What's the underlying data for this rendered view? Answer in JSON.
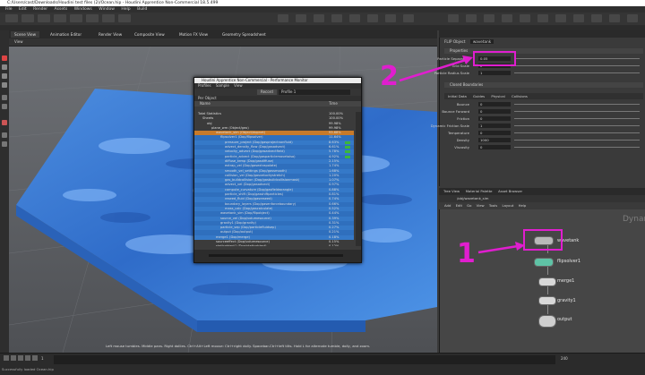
{
  "window": {
    "title": "C:/Users/cast/Downloads/Houdini test files (2)/Ocean.hip - Houdini Apprentice Non-Commercial 18.5.499"
  },
  "menu": [
    "File",
    "Edit",
    "Render",
    "Assets",
    "Windows",
    "Window",
    "Help",
    "Build"
  ],
  "viewport": {
    "tabs": [
      "Scene View",
      "Animation Editor",
      "Render View",
      "Composite View",
      "Motion FX View",
      "Geometry Spreadsheet"
    ],
    "toolbar_label": "View",
    "path": "/obj/wavetank_sim",
    "hint": "Left mouse tumbles. Middle pans. Right dollies. Ctrl+Alt+Left mouse: Ctrl+right dolly. Spacebar-Ctrl+left tilts. Hold L for alternate tumble, dolly, and zoom."
  },
  "perf": {
    "title": "Houdini Apprentice Non-Commercial - Performance Monitor",
    "menu": [
      "Profiles",
      "Sample",
      "View"
    ],
    "record_label": "Record",
    "profile_name": "Profile 1",
    "tab": "Per Object",
    "header": {
      "name": "Name",
      "time": "Time"
    },
    "rows": [
      {
        "indent": 0,
        "label": "Total Statistics",
        "pct": "100.00%",
        "bar": false
      },
      {
        "indent": 1,
        "label": "Sheets",
        "pct": "100.00%",
        "bar": false
      },
      {
        "indent": 2,
        "label": "obj",
        "pct": "99.98%",
        "bar": false
      },
      {
        "indent": 3,
        "label": "plane_wm (Object/geo)",
        "pct": "99.98%",
        "bar": false
      },
      {
        "indent": 4,
        "label": "wavetank_sim (Object/dopnet)",
        "pct": "93.68%",
        "bar": false
      },
      {
        "indent": 5,
        "label": "flipsolver1 (Dop/flipsolver)",
        "pct": "11.64%",
        "bar": false
      },
      {
        "indent": 6,
        "label": "pressure_project (Dop/gasprojectnonfluid)",
        "pct": "8.63%",
        "bar": true
      },
      {
        "indent": 6,
        "label": "advect_density_flow (Dop/gasadvect)",
        "pct": "6.61%",
        "bar": true
      },
      {
        "indent": 6,
        "label": "velocity_advect (Dop/gasadvectfield)",
        "pct": "5.78%",
        "bar": true
      },
      {
        "indent": 6,
        "label": "particle_advect (Dop/gasparticlemovetoiso)",
        "pct": "4.92%",
        "bar": true
      },
      {
        "indent": 6,
        "label": "diffuse_temp (Dop/gasdiffuse)",
        "pct": "2.15%",
        "bar": false
      },
      {
        "indent": 6,
        "label": "extrap_vel (Dop/gasextrapolate)",
        "pct": "1.74%",
        "bar": false
      },
      {
        "indent": 6,
        "label": "smooth_vel_settings (Dop/gassmooth)",
        "pct": "1.68%",
        "bar": false
      },
      {
        "indent": 6,
        "label": "collision_vel (Dop/gasvelocitystretch)",
        "pct": "1.20%",
        "bar": false
      },
      {
        "indent": 6,
        "label": "gas_buildcollision (Dop/gasbuildcollisionmask)",
        "pct": "1.07%",
        "bar": false
      },
      {
        "indent": 6,
        "label": "advect_vel (Dop/gasadvect)",
        "pct": "0.97%",
        "bar": false
      },
      {
        "indent": 6,
        "label": "compute_curvature (Dop/gasfieldwrangle)",
        "pct": "0.88%",
        "bar": false
      },
      {
        "indent": 6,
        "label": "particle_shift (Dop/gasshiftparticles)",
        "pct": "0.81%",
        "bar": false
      },
      {
        "indent": 6,
        "label": "reseed_fluid (Dop/gasreseed)",
        "pct": "0.74%",
        "bar": false
      },
      {
        "indent": 6,
        "label": "boundary_layers (Dop/gasenforceboundary)",
        "pct": "0.66%",
        "bar": false
      },
      {
        "indent": 6,
        "label": "mass_calc (Dop/gascalculate)",
        "pct": "0.52%",
        "bar": false
      },
      {
        "indent": 5,
        "label": "wavetank_sim (Dop/flipobject)",
        "pct": "0.44%",
        "bar": false
      },
      {
        "indent": 5,
        "label": "source_vel (Dop/volumesource)",
        "pct": "0.39%",
        "bar": false
      },
      {
        "indent": 5,
        "label": "gravity1 (Dop/gravity)",
        "pct": "0.31%",
        "bar": false
      },
      {
        "indent": 5,
        "label": "particle_sep (Dop/particlefluidsep)",
        "pct": "0.27%",
        "bar": false
      },
      {
        "indent": 5,
        "label": "output (Dop/output)",
        "pct": "0.21%",
        "bar": false
      },
      {
        "indent": 4,
        "label": "merge1 (Dop/merge)",
        "pct": "0.18%",
        "bar": false
      },
      {
        "indent": 4,
        "label": "sourceeffect (Dop/volumesource)",
        "pct": "0.15%",
        "bar": false
      },
      {
        "indent": 4,
        "label": "staticobject1 (Dop/staticobject)",
        "pct": "0.12%",
        "bar": false
      },
      {
        "indent": 4,
        "label": "collision_source (Sop/vdbfrompolygons)",
        "pct": "0.10%",
        "bar": false
      },
      {
        "indent": 4,
        "label": "ocean_spectrum (Sop/oceanspectrum)",
        "pct": "0.08%",
        "bar": false
      },
      {
        "indent": 4,
        "label": "wave_init (Sop/oceanevaluate)",
        "pct": "0.06%",
        "bar": false
      },
      {
        "indent": 4,
        "label": "timeshift1 (Sop/timeshift)",
        "pct": "0.05%",
        "bar": false
      },
      {
        "indent": 4,
        "label": "file_cache (Sop/filecache)",
        "pct": "0.04%",
        "bar": false
      },
      {
        "indent": 4,
        "label": "pointvelocity (Sop/pointvelocity)",
        "pct": "0.03%",
        "bar": false
      },
      {
        "indent": 4,
        "label": "particlefluidsurface (Sop/particlefluidsurface)",
        "pct": "0.02%",
        "bar": false
      }
    ]
  },
  "params": {
    "node_type": "FLIP Object",
    "node_name": "wavetank",
    "tabs": [
      "Properties",
      "Guides",
      "Physical",
      "Collisions"
    ],
    "section1": "Properties",
    "particle_sep_label": "Particle Separation",
    "particle_sep": "0.05",
    "grid_scale_label": "Grid Scale",
    "grid_scale": "2",
    "particle_radius_label": "Particle Radius Scale",
    "particle_radius": "1",
    "closed_boundaries_label": "Closed Boundaries",
    "subtabs": [
      "Initial Data",
      "Guides",
      "Physical",
      "Collisions"
    ],
    "phys_labels": [
      "Bounce",
      "Bounce Forward",
      "Friction",
      "Dynamic Friction Scale",
      "Temperature",
      "Density",
      "Viscosity"
    ],
    "phys_values": [
      "0",
      "0",
      "0",
      "1",
      "0",
      "1000",
      "0"
    ]
  },
  "network": {
    "tabs": [
      "Tree View",
      "Material Palette",
      "Asset Browser"
    ],
    "path": "/obj/wavetank_sim",
    "menu": [
      "Add",
      "Edit",
      "Go",
      "View",
      "Tools",
      "Layout",
      "Help"
    ],
    "context_label": "Dynamics",
    "nodes": [
      "wavetank",
      "flipsolver1",
      "merge1",
      "gravity1",
      "output"
    ]
  },
  "annotations": {
    "one": "1",
    "two": "2"
  },
  "status": {
    "text": "Successfully loaded Ocean.hip",
    "frame": "1",
    "end": "240"
  }
}
